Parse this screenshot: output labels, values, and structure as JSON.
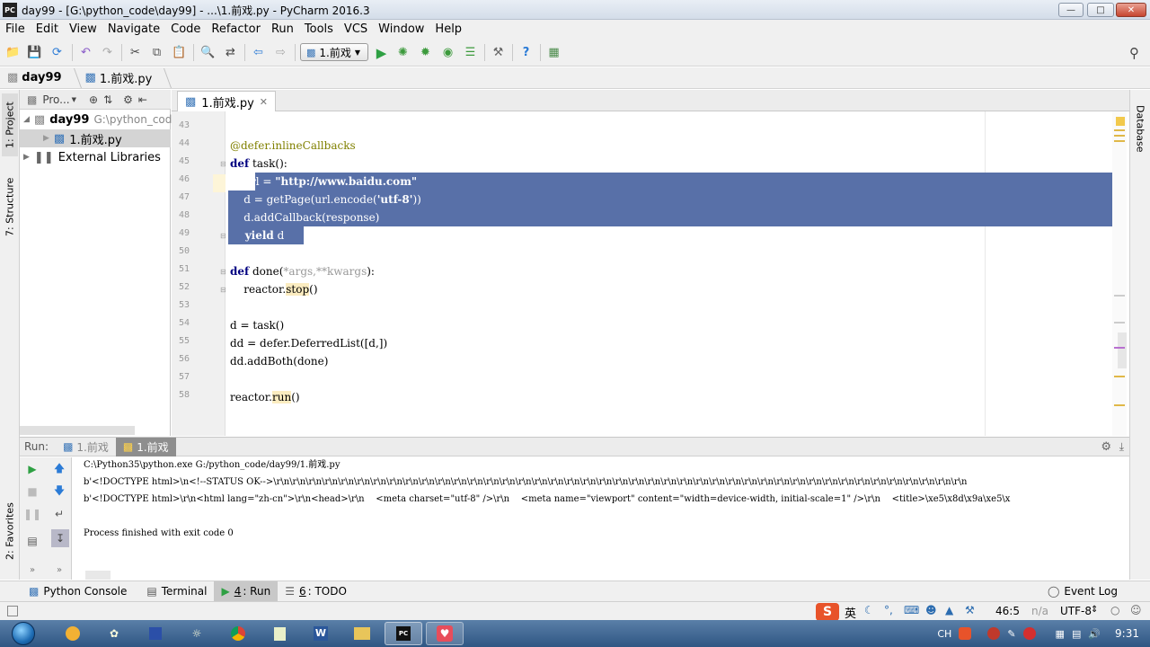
{
  "window": {
    "title": "day99 - [G:\\python_code\\day99] - ...\\1.前戏.py - PyCharm 2016.3",
    "app_icon": "PC"
  },
  "menu": [
    "File",
    "Edit",
    "View",
    "Navigate",
    "Code",
    "Refactor",
    "Run",
    "Tools",
    "VCS",
    "Window",
    "Help"
  ],
  "toolbar": {
    "run_config": "1.前戏"
  },
  "breadcrumb": [
    "day99",
    "1.前戏.py"
  ],
  "left_stripe": {
    "project_tab": "1: Project",
    "structure_tab": "7: Structure",
    "favorites_tab": "2: Favorites"
  },
  "right_stripe": {
    "database_tab": "Database"
  },
  "project_panel": {
    "header": "Pro...",
    "root_name": "day99",
    "root_path": "G:\\python_cod",
    "file": "1.前戏.py",
    "external": "External Libraries"
  },
  "editor": {
    "tab_label": "1.前戏.py",
    "line_numbers": [
      "43",
      "44",
      "45",
      "46",
      "47",
      "48",
      "49",
      "50",
      "51",
      "52",
      "53",
      "54",
      "55",
      "56",
      "57",
      "58"
    ]
  },
  "code": {
    "l44": "@defer.inlineCallbacks",
    "l45_kw": "def",
    "l45_rest": " task():",
    "l46_pre": "    url = ",
    "l46_str": "\"http://www.baidu.com\"",
    "l47_pre": "    d = getPage(url.encode(",
    "l47_str": "'utf-8'",
    "l47_post": "))",
    "l48": "    d.addCallback(response)",
    "l49_kw": "    yield",
    "l49_rest": " d",
    "l51_kw": "def",
    "l51_a": " done(",
    "l51_p": "*args,**kwargs",
    "l51_b": "):",
    "l52_a": "    reactor.",
    "l52_fn": "stop",
    "l52_b": "()",
    "l54": "d = task()",
    "l55": "dd = defer.DeferredList([d,])",
    "l56": "dd.addBoth(done)",
    "l58_a": "reactor.",
    "l58_fn": "run",
    "l58_b": "()"
  },
  "run_panel": {
    "label": "Run:",
    "tab1": "1.前戏",
    "tab2": "1.前戏"
  },
  "console": {
    "line1": "C:\\Python35\\python.exe G:/python_code/day99/1.前戏.py",
    "line2": "b'<!DOCTYPE html>\\n<!--STATUS OK-->\\r\\n\\r\\n\\r\\n\\r\\n\\r\\n\\r\\n\\r\\n\\r\\n\\r\\n\\r\\n\\r\\n\\r\\n\\r\\n\\r\\n\\r\\n\\r\\n\\r\\n\\r\\n\\r\\n\\r\\n\\r\\n\\r\\n\\r\\n\\r\\n\\r\\n\\r\\n\\r\\n\\r\\n\\r\\n\\r\\n\\r\\n\\r\\n\\r\\n\\r\\n\\r\\n\\r\\n\\r\\n\\r\\n\\r\\n\\r\\n\\r\\n\\r\\n\\r\\n",
    "line3": "b'<!DOCTYPE html>\\r\\n<html lang=\"zh-cn\">\\r\\n<head>\\r\\n    <meta charset=\"utf-8\" />\\r\\n    <meta name=\"viewport\" content=\"width=device-width, initial-scale=1\" />\\r\\n    <title>\\xe5\\x8d\\x9a\\xe5\\x",
    "line4": "Process finished with exit code 0"
  },
  "bottom_tools": {
    "python_console": "Python Console",
    "terminal": "Terminal",
    "run_num": "4",
    "run": ": Run",
    "todo_num": "6",
    "todo": ": TODO",
    "event_log": "Event Log"
  },
  "status": {
    "position": "46:5",
    "na": "n/a",
    "encoding": "UTF-8",
    "ime": "英"
  },
  "taskbar": {
    "lang": "CH",
    "time": "9:31"
  }
}
